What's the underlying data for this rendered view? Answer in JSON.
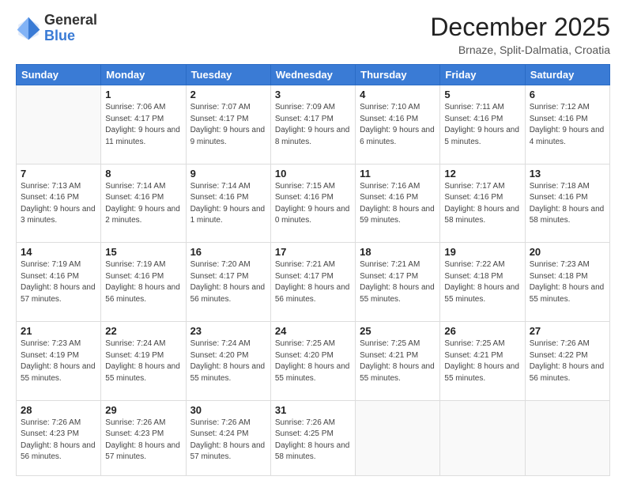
{
  "header": {
    "logo": {
      "general": "General",
      "blue": "Blue"
    },
    "title": "December 2025",
    "location": "Brnaze, Split-Dalmatia, Croatia"
  },
  "weekdays": [
    "Sunday",
    "Monday",
    "Tuesday",
    "Wednesday",
    "Thursday",
    "Friday",
    "Saturday"
  ],
  "weeks": [
    [
      {
        "day": "",
        "sunrise": "",
        "sunset": "",
        "daylight": ""
      },
      {
        "day": "1",
        "sunrise": "Sunrise: 7:06 AM",
        "sunset": "Sunset: 4:17 PM",
        "daylight": "Daylight: 9 hours and 11 minutes."
      },
      {
        "day": "2",
        "sunrise": "Sunrise: 7:07 AM",
        "sunset": "Sunset: 4:17 PM",
        "daylight": "Daylight: 9 hours and 9 minutes."
      },
      {
        "day": "3",
        "sunrise": "Sunrise: 7:09 AM",
        "sunset": "Sunset: 4:17 PM",
        "daylight": "Daylight: 9 hours and 8 minutes."
      },
      {
        "day": "4",
        "sunrise": "Sunrise: 7:10 AM",
        "sunset": "Sunset: 4:16 PM",
        "daylight": "Daylight: 9 hours and 6 minutes."
      },
      {
        "day": "5",
        "sunrise": "Sunrise: 7:11 AM",
        "sunset": "Sunset: 4:16 PM",
        "daylight": "Daylight: 9 hours and 5 minutes."
      },
      {
        "day": "6",
        "sunrise": "Sunrise: 7:12 AM",
        "sunset": "Sunset: 4:16 PM",
        "daylight": "Daylight: 9 hours and 4 minutes."
      }
    ],
    [
      {
        "day": "7",
        "sunrise": "Sunrise: 7:13 AM",
        "sunset": "Sunset: 4:16 PM",
        "daylight": "Daylight: 9 hours and 3 minutes."
      },
      {
        "day": "8",
        "sunrise": "Sunrise: 7:14 AM",
        "sunset": "Sunset: 4:16 PM",
        "daylight": "Daylight: 9 hours and 2 minutes."
      },
      {
        "day": "9",
        "sunrise": "Sunrise: 7:14 AM",
        "sunset": "Sunset: 4:16 PM",
        "daylight": "Daylight: 9 hours and 1 minute."
      },
      {
        "day": "10",
        "sunrise": "Sunrise: 7:15 AM",
        "sunset": "Sunset: 4:16 PM",
        "daylight": "Daylight: 9 hours and 0 minutes."
      },
      {
        "day": "11",
        "sunrise": "Sunrise: 7:16 AM",
        "sunset": "Sunset: 4:16 PM",
        "daylight": "Daylight: 8 hours and 59 minutes."
      },
      {
        "day": "12",
        "sunrise": "Sunrise: 7:17 AM",
        "sunset": "Sunset: 4:16 PM",
        "daylight": "Daylight: 8 hours and 58 minutes."
      },
      {
        "day": "13",
        "sunrise": "Sunrise: 7:18 AM",
        "sunset": "Sunset: 4:16 PM",
        "daylight": "Daylight: 8 hours and 58 minutes."
      }
    ],
    [
      {
        "day": "14",
        "sunrise": "Sunrise: 7:19 AM",
        "sunset": "Sunset: 4:16 PM",
        "daylight": "Daylight: 8 hours and 57 minutes."
      },
      {
        "day": "15",
        "sunrise": "Sunrise: 7:19 AM",
        "sunset": "Sunset: 4:16 PM",
        "daylight": "Daylight: 8 hours and 56 minutes."
      },
      {
        "day": "16",
        "sunrise": "Sunrise: 7:20 AM",
        "sunset": "Sunset: 4:17 PM",
        "daylight": "Daylight: 8 hours and 56 minutes."
      },
      {
        "day": "17",
        "sunrise": "Sunrise: 7:21 AM",
        "sunset": "Sunset: 4:17 PM",
        "daylight": "Daylight: 8 hours and 56 minutes."
      },
      {
        "day": "18",
        "sunrise": "Sunrise: 7:21 AM",
        "sunset": "Sunset: 4:17 PM",
        "daylight": "Daylight: 8 hours and 55 minutes."
      },
      {
        "day": "19",
        "sunrise": "Sunrise: 7:22 AM",
        "sunset": "Sunset: 4:18 PM",
        "daylight": "Daylight: 8 hours and 55 minutes."
      },
      {
        "day": "20",
        "sunrise": "Sunrise: 7:23 AM",
        "sunset": "Sunset: 4:18 PM",
        "daylight": "Daylight: 8 hours and 55 minutes."
      }
    ],
    [
      {
        "day": "21",
        "sunrise": "Sunrise: 7:23 AM",
        "sunset": "Sunset: 4:19 PM",
        "daylight": "Daylight: 8 hours and 55 minutes."
      },
      {
        "day": "22",
        "sunrise": "Sunrise: 7:24 AM",
        "sunset": "Sunset: 4:19 PM",
        "daylight": "Daylight: 8 hours and 55 minutes."
      },
      {
        "day": "23",
        "sunrise": "Sunrise: 7:24 AM",
        "sunset": "Sunset: 4:20 PM",
        "daylight": "Daylight: 8 hours and 55 minutes."
      },
      {
        "day": "24",
        "sunrise": "Sunrise: 7:25 AM",
        "sunset": "Sunset: 4:20 PM",
        "daylight": "Daylight: 8 hours and 55 minutes."
      },
      {
        "day": "25",
        "sunrise": "Sunrise: 7:25 AM",
        "sunset": "Sunset: 4:21 PM",
        "daylight": "Daylight: 8 hours and 55 minutes."
      },
      {
        "day": "26",
        "sunrise": "Sunrise: 7:25 AM",
        "sunset": "Sunset: 4:21 PM",
        "daylight": "Daylight: 8 hours and 55 minutes."
      },
      {
        "day": "27",
        "sunrise": "Sunrise: 7:26 AM",
        "sunset": "Sunset: 4:22 PM",
        "daylight": "Daylight: 8 hours and 56 minutes."
      }
    ],
    [
      {
        "day": "28",
        "sunrise": "Sunrise: 7:26 AM",
        "sunset": "Sunset: 4:23 PM",
        "daylight": "Daylight: 8 hours and 56 minutes."
      },
      {
        "day": "29",
        "sunrise": "Sunrise: 7:26 AM",
        "sunset": "Sunset: 4:23 PM",
        "daylight": "Daylight: 8 hours and 57 minutes."
      },
      {
        "day": "30",
        "sunrise": "Sunrise: 7:26 AM",
        "sunset": "Sunset: 4:24 PM",
        "daylight": "Daylight: 8 hours and 57 minutes."
      },
      {
        "day": "31",
        "sunrise": "Sunrise: 7:26 AM",
        "sunset": "Sunset: 4:25 PM",
        "daylight": "Daylight: 8 hours and 58 minutes."
      },
      {
        "day": "",
        "sunrise": "",
        "sunset": "",
        "daylight": ""
      },
      {
        "day": "",
        "sunrise": "",
        "sunset": "",
        "daylight": ""
      },
      {
        "day": "",
        "sunrise": "",
        "sunset": "",
        "daylight": ""
      }
    ]
  ]
}
